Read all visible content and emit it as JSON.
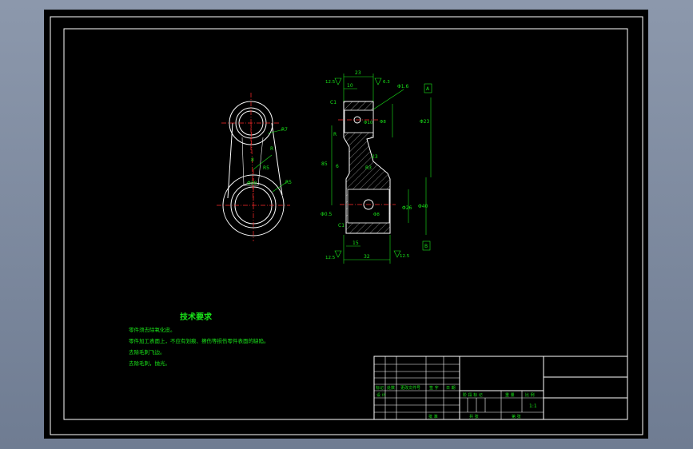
{
  "colors": {
    "workspace": "#000000",
    "frame": "#ffffff",
    "centerline": "#ff2a2a",
    "annotation": "#19e619",
    "desktop": "#7b879c"
  },
  "front_view": {
    "labels": {
      "top_radius": "R7",
      "bottom_radius": "R5",
      "top_slot": "R",
      "mid_depth": "8",
      "mid_note": "R5",
      "bore": "Φ30"
    }
  },
  "section_view": {
    "labels": {
      "top_width": "23",
      "top_inner": "10",
      "rough_left": "12.5",
      "rough_right": "6.3",
      "chamfer_top": "C1",
      "angle_top": "Φ1.6",
      "top_hole": "Φ10",
      "hole_depth": "Φ8",
      "top_height": "Φ23",
      "datum_a": "A",
      "datum_b": "B",
      "overall_height": "85",
      "web_mark": "R",
      "web_width": "23",
      "web_thick": "6",
      "web_note": "R3",
      "bottom_hole": "Φ26",
      "bottom_height": "Φ40",
      "bottom_small": "Φ8",
      "bottom_rough": "Φ0.5",
      "chamfer_bottom": "C1",
      "bottom_inner": "15",
      "bottom_width": "32",
      "rough_bl": "12.5",
      "rough_br": "12.5"
    }
  },
  "technical_requirements": {
    "title": "技术要求",
    "items": [
      "零件须去除氧化皮。",
      "零件加工表面上，不应有划痕、擦伤等损伤零件表面的缺陷。",
      "去除毛刺飞边。",
      "去除毛刺，抛光。"
    ]
  },
  "title_block": {
    "cells": {
      "mark": "标记",
      "count": "处数",
      "change_doc": "更改文件号",
      "signature": "签 字",
      "date": "日 期",
      "design": "设 计",
      "stage_mark": "阶 段 标 记",
      "weight": "重 量",
      "scale_label": "比 例",
      "scale": "1:1",
      "approve": "批 准",
      "sheet_total": "共 张",
      "sheet_no": "第 张"
    }
  }
}
